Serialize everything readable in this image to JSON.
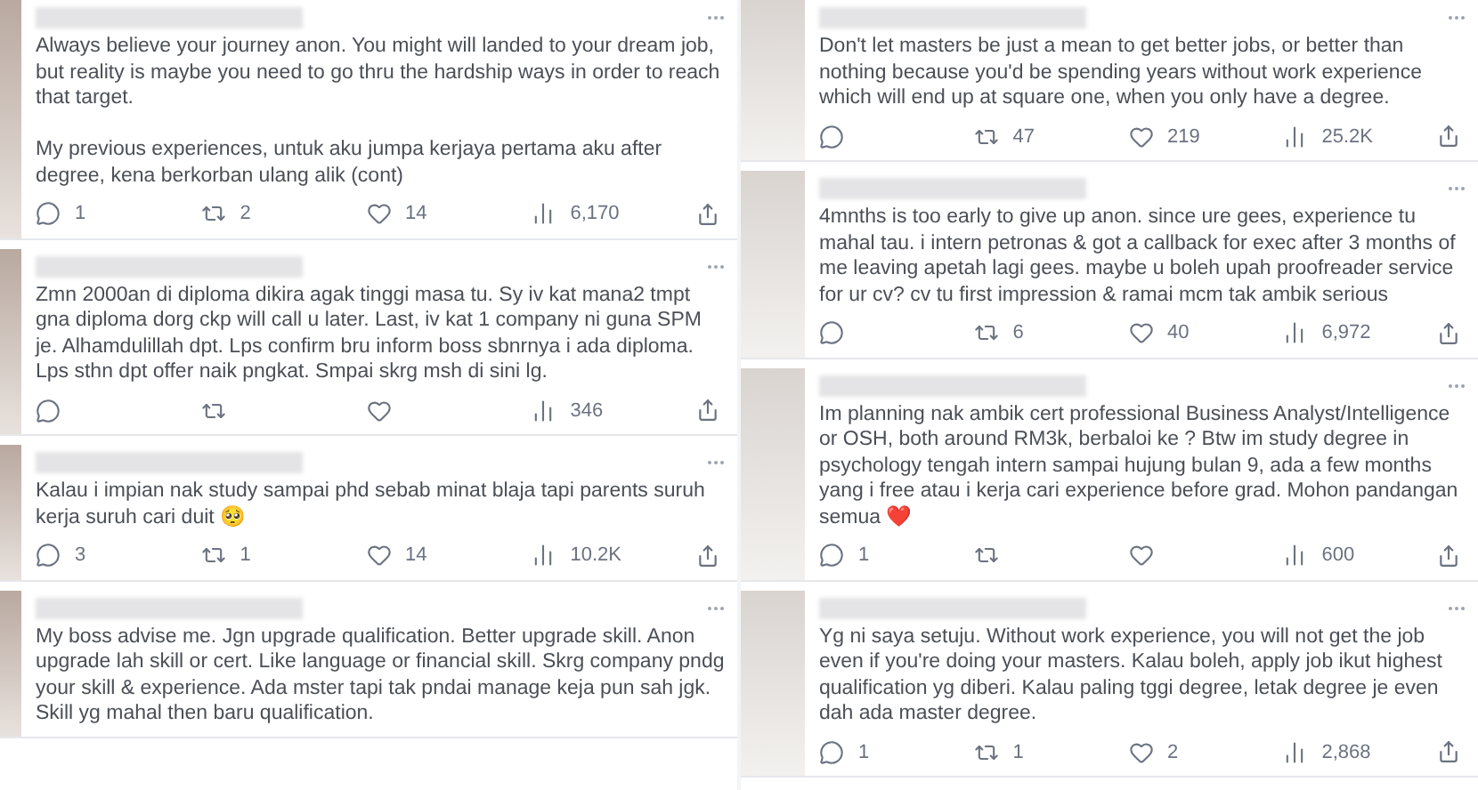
{
  "columns": [
    {
      "tweets": [
        {
          "text": "Always believe your journey anon. You might will landed to your dream job, but reality is maybe you need to go thru the hardship ways in order to reach that target.\n\nMy previous experiences, untuk aku jumpa kerjaya pertama aku after degree, kena berkorban ulang alik (cont)",
          "stats": {
            "replies": "1",
            "retweets": "2",
            "likes": "14",
            "views": "6,170"
          }
        },
        {
          "text": "Zmn 2000an di diploma dikira agak tinggi masa tu. Sy iv kat mana2 tmpt gna diploma dorg ckp will call u later. Last, iv kat 1 company ni guna SPM je. Alhamdulillah dpt. Lps confirm bru inform boss sbnrnya i ada diploma. Lps sthn dpt offer naik pngkat. Smpai skrg msh di sini lg.",
          "stats": {
            "views": "346"
          }
        },
        {
          "text": "Kalau i impian nak study sampai phd sebab minat blaja tapi parents suruh kerja suruh cari duit 🥺",
          "stats": {
            "replies": "3",
            "retweets": "1",
            "likes": "14",
            "views": "10.2K"
          }
        },
        {
          "text": "My boss advise me. Jgn upgrade qualification. Better upgrade skill. Anon upgrade lah skill or cert. Like language or financial skill. Skrg company pndg your skill & experience. Ada mster tapi tak pndai manage keja pun sah jgk. Skill yg mahal then baru qualification."
        }
      ]
    },
    {
      "tweets": [
        {
          "text": "Don't let masters be just a mean to get better jobs, or better than nothing because you'd be spending years without work experience which will end up at square one, when you only have a degree.",
          "stats": {
            "retweets": "47",
            "likes": "219",
            "views": "25.2K"
          }
        },
        {
          "text": "4mnths is too early to give up anon. since ure gees, experience tu mahal tau. i intern petronas & got a callback for exec after 3 months of me leaving apetah lagi gees. maybe u boleh upah proofreader service for ur cv? cv tu first impression & ramai mcm tak ambik serious",
          "stats": {
            "retweets": "6",
            "likes": "40",
            "views": "6,972"
          }
        },
        {
          "text": "Im planning nak ambik cert professional Business Analyst/Intelligence or OSH, both around RM3k, berbaloi ke ? Btw im study degree in psychology tengah intern sampai hujung bulan 9, ada a few months yang i free atau i kerja cari experience before grad. Mohon pandangan semua ❤️",
          "stats": {
            "replies": "1",
            "views": "600"
          }
        },
        {
          "text": "Yg ni saya setuju. Without work experience, you will not get the job even if you're doing your masters. Kalau boleh, apply job ikut highest qualification yg diberi. Kalau paling tggi degree, letak degree je even dah ada master degree.",
          "stats": {
            "replies": "1",
            "retweets": "1",
            "likes": "2",
            "views": "2,868"
          }
        }
      ]
    }
  ]
}
